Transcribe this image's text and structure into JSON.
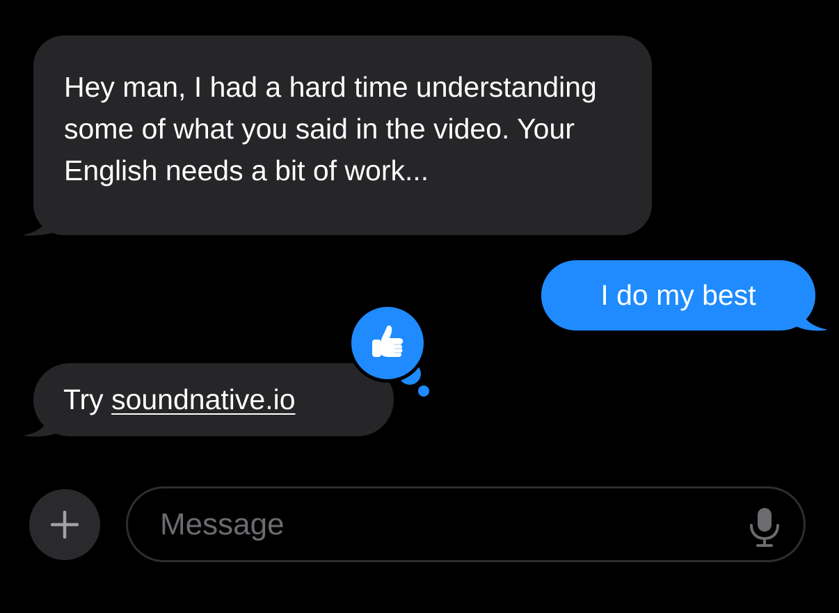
{
  "conversation": {
    "messages": [
      {
        "direction": "incoming",
        "text": "Hey man, I had a hard time understanding some of what you said in the video. Your English needs a bit of work..."
      },
      {
        "direction": "outgoing",
        "text": "I do my best"
      },
      {
        "direction": "incoming",
        "prefix": "Try ",
        "link": "soundnative.io"
      }
    ],
    "reaction": {
      "icon": "thumbs-up-icon",
      "target_message": 3
    }
  },
  "composer": {
    "placeholder": "Message",
    "plus_icon": "plus-icon",
    "mic_icon": "microphone-icon"
  },
  "colors": {
    "background": "#000000",
    "incoming_bubble": "#262628",
    "outgoing_bubble": "#1f8bff",
    "text": "#ffffff",
    "placeholder": "#6b6b70"
  }
}
